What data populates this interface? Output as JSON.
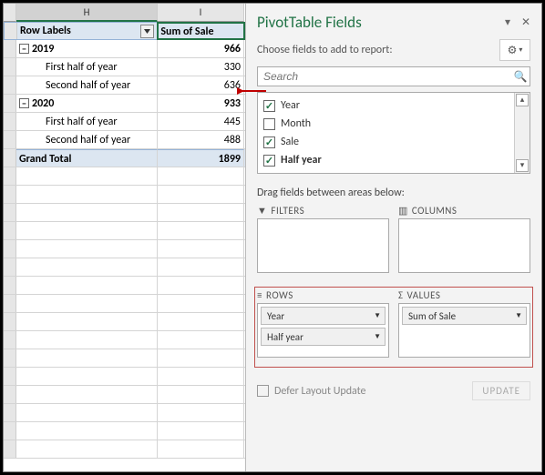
{
  "columns": {
    "left": "H",
    "right": "I"
  },
  "pivot": {
    "row_label_header": "Row Labels",
    "value_header": "Sum of Sale",
    "groups": [
      {
        "label": "2019",
        "value": 966,
        "sub": [
          {
            "label": "First half of year",
            "value": 330
          },
          {
            "label": "Second half of year",
            "value": 636
          }
        ]
      },
      {
        "label": "2020",
        "value": 933,
        "sub": [
          {
            "label": "First half of year",
            "value": 445
          },
          {
            "label": "Second half of year",
            "value": 488
          }
        ]
      }
    ],
    "grand_label": "Grand Total",
    "grand_value": 1899
  },
  "pane": {
    "title": "PivotTable Fields",
    "choose_label": "Choose fields to add to report:",
    "search_placeholder": "Search",
    "fields": [
      {
        "name": "Year",
        "checked": true,
        "bold": false
      },
      {
        "name": "Month",
        "checked": false,
        "bold": false
      },
      {
        "name": "Sale",
        "checked": true,
        "bold": false
      },
      {
        "name": "Half year",
        "checked": true,
        "bold": true
      }
    ],
    "drag_label": "Drag fields between areas below:",
    "areas": {
      "filters": "FILTERS",
      "columns": "COLUMNS",
      "rows": "ROWS",
      "values": "VALUES"
    },
    "row_fields": [
      "Year",
      "Half year"
    ],
    "value_fields": [
      "Sum of Sale"
    ],
    "defer_label": "Defer Layout Update",
    "update_label": "UPDATE"
  }
}
